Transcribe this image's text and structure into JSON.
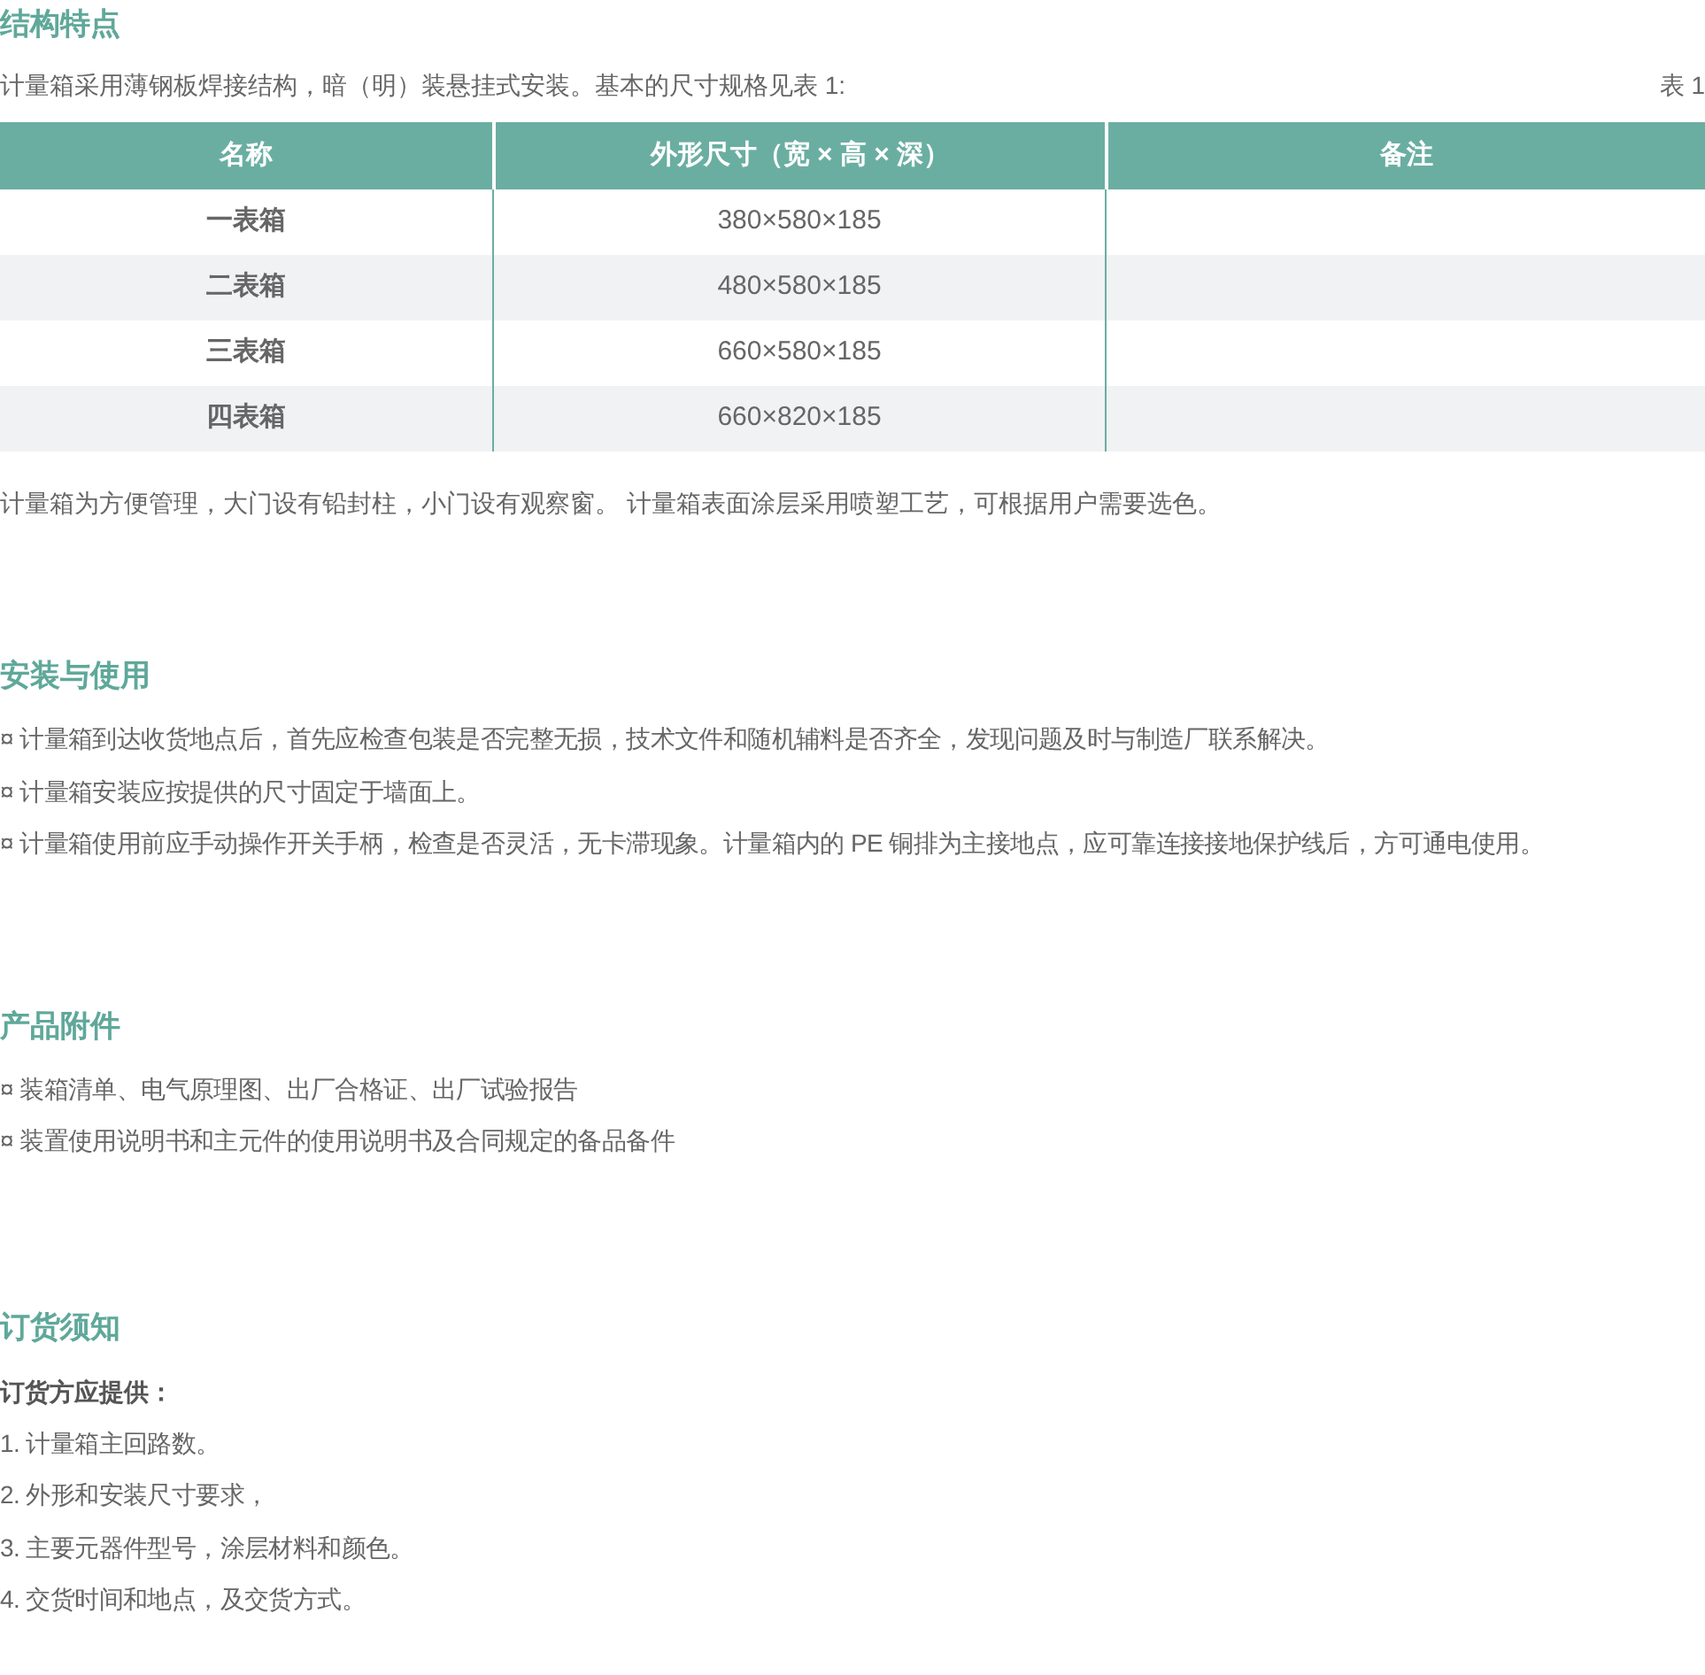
{
  "sections": [
    {
      "title": "结构特点",
      "kind": "table",
      "intro": "计量箱采用薄钢板焊接结构，暗（明）装悬挂式安装。基本的尺寸规格见表 1:",
      "caption": "表 1",
      "table": {
        "columns": [
          "名称",
          "外形尺寸（宽 × 高 × 深）",
          "备注"
        ],
        "rows": [
          [
            "一表箱",
            "380×580×185",
            ""
          ],
          [
            "二表箱",
            "480×580×185",
            ""
          ],
          [
            "三表箱",
            "660×580×185",
            ""
          ],
          [
            "四表箱",
            "660×820×185",
            ""
          ]
        ]
      },
      "note": "计量箱为方便管理，大门设有铅封柱，小门设有观察窗。 计量箱表面涂层采用喷塑工艺，可根据用户需要选色。"
    },
    {
      "title": "安装与使用",
      "kind": "list",
      "items": [
        "¤ 计量箱到达收货地点后，首先应检查包装是否完整无损，技术文件和随机辅料是否齐全，发现问题及时与制造厂联系解决。",
        "¤ 计量箱安装应按提供的尺寸固定于墙面上。",
        "¤ 计量箱使用前应手动操作开关手柄，检查是否灵活，无卡滞现象。计量箱内的 PE 铜排为主接地点，应可靠连接接地保护线后，方可通电使用。"
      ]
    },
    {
      "title": "产品附件",
      "kind": "list",
      "items": [
        "¤ 装箱清单、电气原理图、出厂合格证、出厂试验报告",
        "¤ 装置使用说明书和主元件的使用说明书及合同规定的备品备件"
      ]
    },
    {
      "title": "订货须知",
      "kind": "list",
      "lead": "订货方应提供：",
      "items": [
        "1. 计量箱主回路数。",
        "2. 外形和安装尺寸要求，",
        "3. 主要元器件型号，涂层材料和颜色。",
        "4. 交货时间和地点，及交货方式。"
      ]
    }
  ]
}
